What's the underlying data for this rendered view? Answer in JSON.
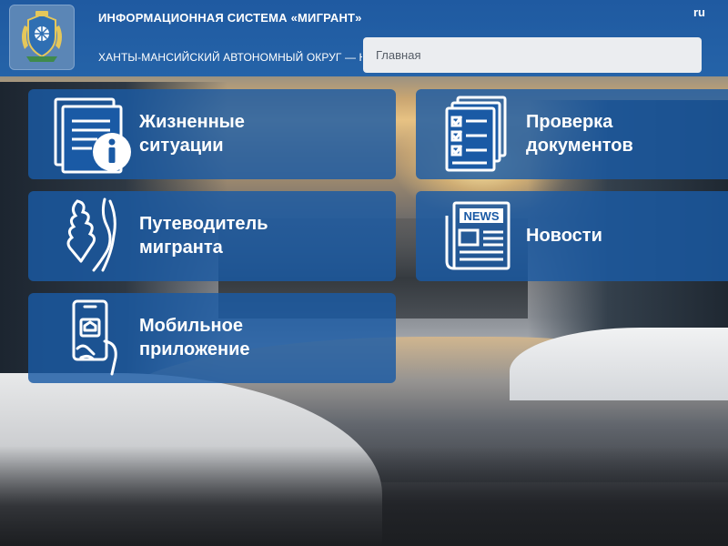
{
  "header": {
    "title": "ИНФОРМАЦИОННАЯ СИСТЕМА «МИГРАНТ»",
    "subtitle": "ХАНТЫ-МАНСИЙСКИЙ АВТОНОМНЫЙ ОКРУГ — ЮГРА",
    "lang": "ru",
    "logo_icon": "coat-of-arms-icon"
  },
  "search": {
    "placeholder": "Главная"
  },
  "tiles": [
    {
      "label": "Жизненные ситуации",
      "icon": "document-info-icon"
    },
    {
      "label": "Проверка документов",
      "icon": "checklist-icon"
    },
    {
      "label": "Путеводитель мигранта",
      "icon": "handshake-icon"
    },
    {
      "label": "Новости",
      "icon": "newspaper-icon"
    },
    {
      "label": "Мобильное приложение",
      "icon": "mobile-phone-icon"
    }
  ],
  "colors": {
    "header": "#2563a8",
    "tile": "#1a5aa5",
    "search_bg": "#ebedf0"
  }
}
